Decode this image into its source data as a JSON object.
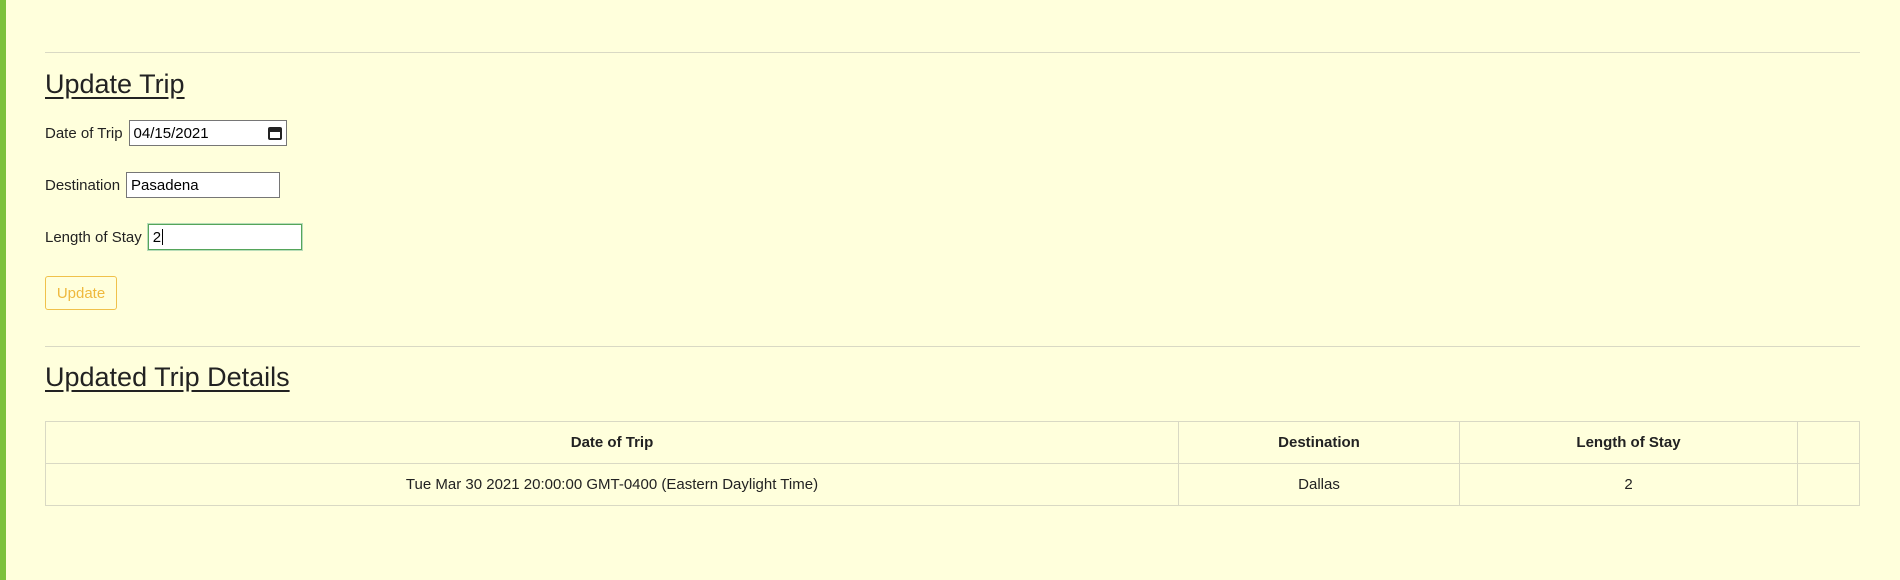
{
  "update_form": {
    "title": "Update Trip",
    "date_label": "Date of Trip",
    "date_value": "04/15/2021",
    "destination_label": "Destination",
    "destination_value": "Pasadena",
    "length_label": "Length of Stay",
    "length_value": "2",
    "update_button": "Update"
  },
  "details": {
    "title": "Updated Trip Details",
    "columns": [
      "Date of Trip",
      "Destination",
      "Length of Stay",
      ""
    ],
    "rows": [
      [
        "Tue Mar 30 2021 20:00:00 GMT-0400 (Eastern Daylight Time)",
        "Dallas",
        "2",
        ""
      ]
    ]
  },
  "colors": {
    "background": "#ffffdc",
    "left_accent": "#7cc13c",
    "button_accent": "#efb93d",
    "focus_border": "#55a55a"
  },
  "icons": {
    "date_picker": "calendar-icon"
  }
}
